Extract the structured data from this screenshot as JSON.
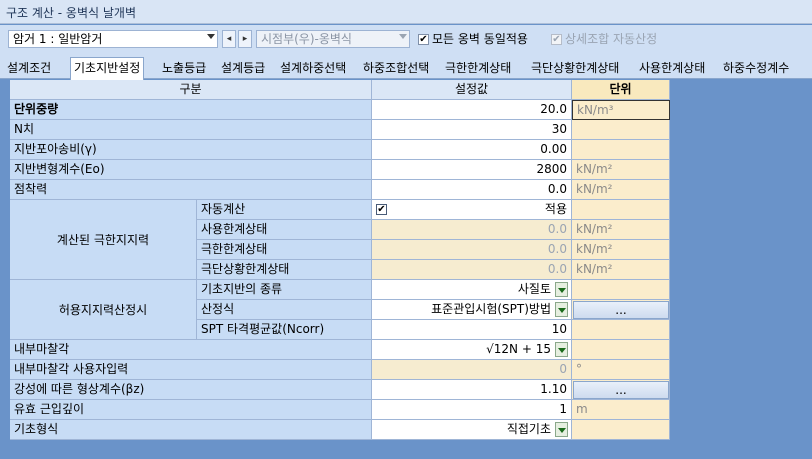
{
  "window": {
    "title": "구조 계산 - 옹벽식 날개벽"
  },
  "toolbar": {
    "case_combo": "암거 1 : 일반암거",
    "prev_label": "◂",
    "next_label": "▸",
    "side_combo": "시점부(우)-옹벽식",
    "same_wall": {
      "label": "모든 옹벽 동일적용",
      "checked": true
    },
    "detail_combo": {
      "label": "상세조합 자동산정",
      "checked": true,
      "disabled": true
    }
  },
  "tabs": [
    "설계조건",
    "기초지반설정",
    "노출등급",
    "설계등급",
    "설계하중선택",
    "하중조합선택",
    "극한한계상태",
    "극단상황한계상태",
    "사용한계상태",
    "하중수정계수"
  ],
  "active_tab": 1,
  "table": {
    "headers": {
      "item": "구분",
      "value": "설정값",
      "unit": "단위"
    },
    "rows": {
      "unit_weight": {
        "label": "단위중량",
        "value": "20.0",
        "unit": "kN/m³"
      },
      "n_value": {
        "label": "N치",
        "value": "30",
        "unit": ""
      },
      "poisson": {
        "label": "지반포아송비(γ)",
        "value": "0.00",
        "unit": ""
      },
      "modulus": {
        "label": "지반변형계수(Eo)",
        "value": "2800",
        "unit": "kN/m²"
      },
      "cohesion": {
        "label": "점착력",
        "value": "0.0",
        "unit": "kN/m²"
      },
      "bearing_group": {
        "label": "계산된 극한지지력",
        "auto": {
          "label": "자동계산",
          "value": "적용",
          "checked": true
        },
        "service": {
          "label": "사용한계상태",
          "value": "0.0",
          "unit": "kN/m²"
        },
        "ultimate": {
          "label": "극한한계상태",
          "value": "0.0",
          "unit": "kN/m²"
        },
        "extreme": {
          "label": "극단상황한계상태",
          "value": "0.0",
          "unit": "kN/m²"
        }
      },
      "allowable_group": {
        "label": "허용지지력산정시",
        "soil_type": {
          "label": "기초지반의 종류",
          "value": "사질토"
        },
        "formula": {
          "label": "산정식",
          "value": "표준관입시험(SPT)방법",
          "button": "..."
        },
        "spt_avg": {
          "label": "SPT 타격평균값(Ncorr)",
          "value": "10"
        }
      },
      "friction_angle": {
        "label": "내부마찰각",
        "value": "√12N + 15"
      },
      "friction_user": {
        "label": "내부마찰각 사용자입력",
        "value": "0",
        "unit": "°"
      },
      "shape_factor": {
        "label": "강성에 따른 형상계수(βz)",
        "value": "1.10",
        "button": "..."
      },
      "depth": {
        "label": "유효 근입깊이",
        "value": "1",
        "unit": "m"
      },
      "foundation": {
        "label": "기초형식",
        "value": "직접기초"
      }
    }
  }
}
